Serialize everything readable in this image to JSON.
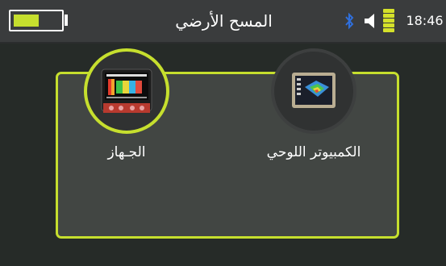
{
  "status_bar": {
    "title": "المسح الأرضي",
    "time": "18:46",
    "battery_level": 0.55,
    "icons": [
      "battery-icon",
      "bluetooth-icon",
      "speaker-icon",
      "signal-icon"
    ],
    "colors": {
      "accent": "#c6df2e",
      "bar": "#3a3c3d"
    }
  },
  "modes": [
    {
      "label": "الجـهاز",
      "icon": "device-icon",
      "selected": true
    },
    {
      "label": "الكمبيوتر اللوحي",
      "icon": "tablet-icon",
      "selected": false
    }
  ],
  "colors": {
    "background": "#262b28",
    "panel": "#424643",
    "accent": "#c6df2e"
  }
}
